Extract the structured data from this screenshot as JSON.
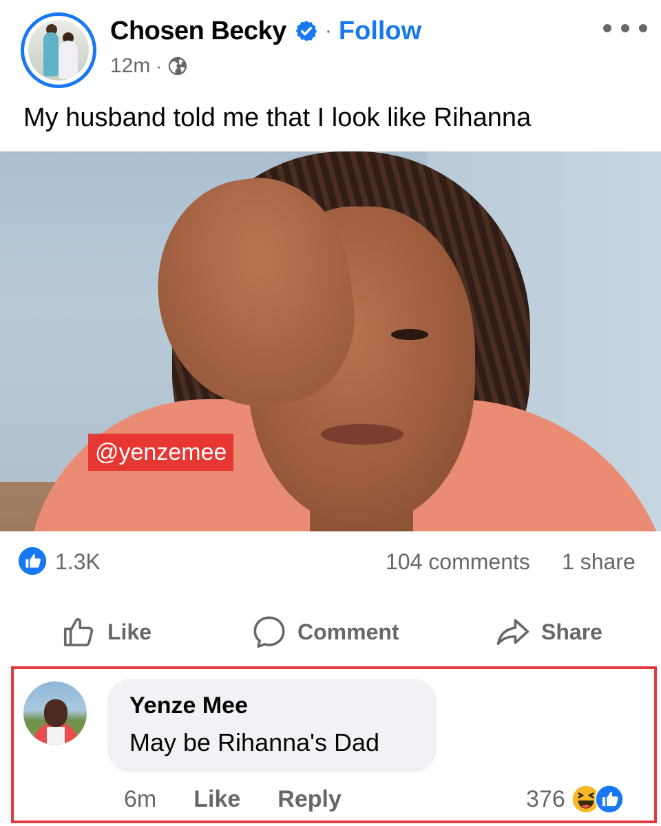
{
  "post": {
    "author": "Chosen Becky",
    "follow_label": "Follow",
    "separator": "·",
    "time": "12m",
    "meta_dot": "·",
    "caption": "My husband told me that I look like Rihanna",
    "photo_watermark": "@yenzemee"
  },
  "stats": {
    "reactions": "1.3K",
    "comments": "104 comments",
    "shares": "1 share"
  },
  "actions": {
    "like": "Like",
    "comment": "Comment",
    "share": "Share"
  },
  "comment": {
    "author": "Yenze Mee",
    "text": "May be Rihanna's Dad",
    "time": "6m",
    "like_label": "Like",
    "reply_label": "Reply",
    "reaction_count": "376"
  },
  "icons": {
    "verified": "verified-badge-icon",
    "privacy": "globe-icon",
    "more": "more-options-icon",
    "like_reaction": "like-reaction-icon",
    "haha_reaction": "haha-reaction-icon"
  },
  "colors": {
    "brand_blue": "#1877f2",
    "secondary_text": "#65676b",
    "highlight_border": "#e03a3e",
    "bubble_bg": "#f0f2f5"
  }
}
